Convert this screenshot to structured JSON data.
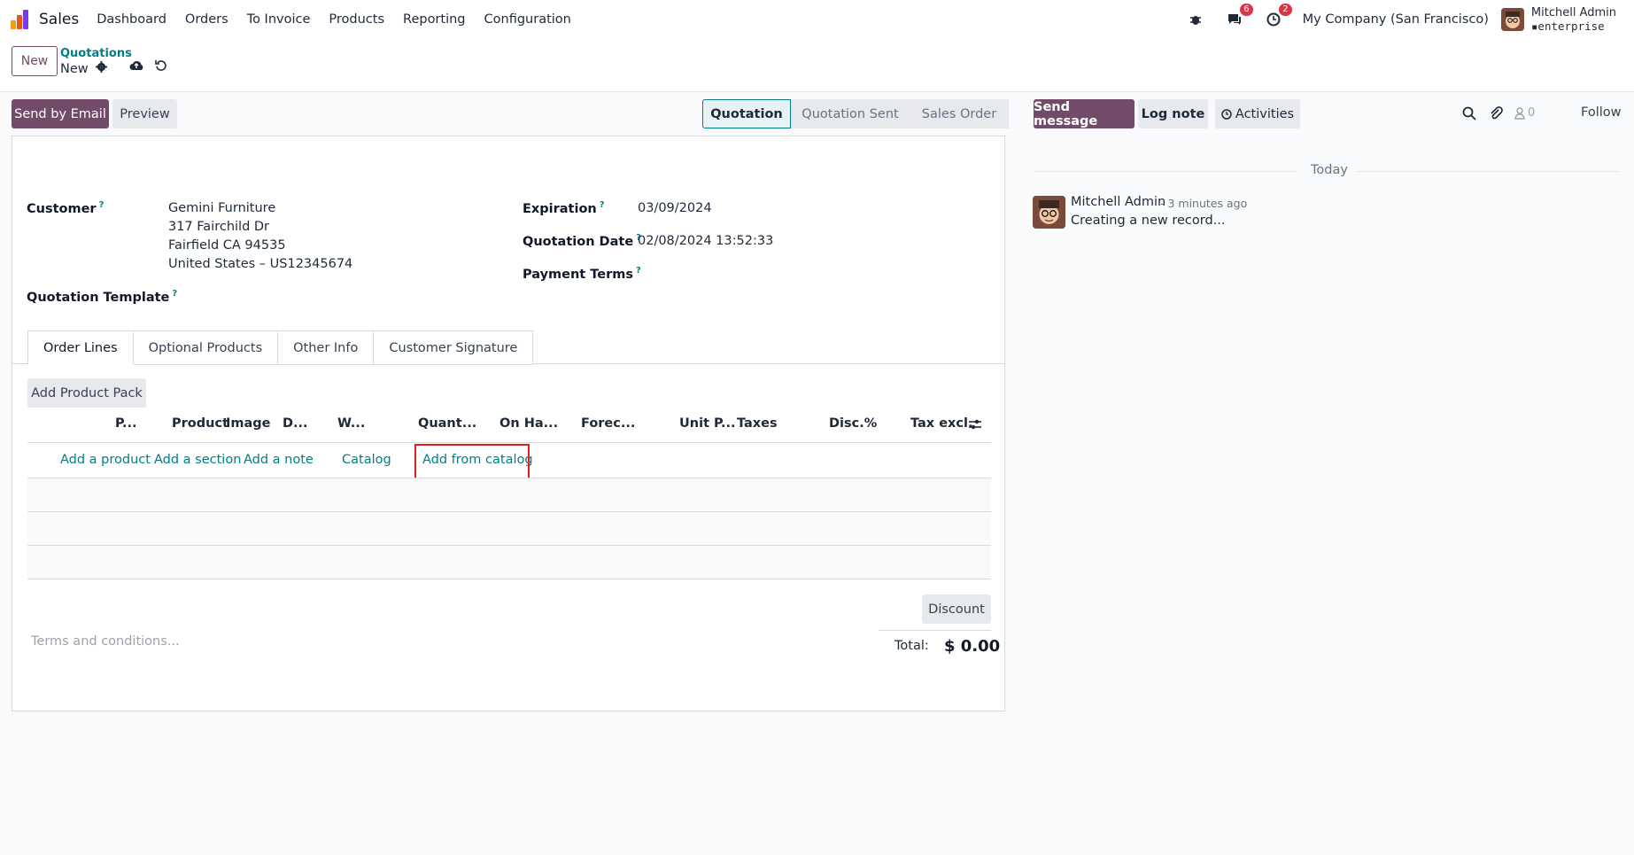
{
  "app": {
    "name": "Sales"
  },
  "menu": [
    "Dashboard",
    "Orders",
    "To Invoice",
    "Products",
    "Reporting",
    "Configuration"
  ],
  "nav": {
    "chat_count": "6",
    "activity_count": "2",
    "company": "My Company (San Francisco)",
    "user": "Mitchell Admin",
    "database": "enterprise"
  },
  "breadcrumb": {
    "parent": "Quotations",
    "current": "New"
  },
  "buttons": {
    "new": "New",
    "send_email": "Send by Email",
    "preview": "Preview",
    "add_pack": "Add Product Pack",
    "discount": "Discount"
  },
  "status_stages": [
    "Quotation",
    "Quotation Sent",
    "Sales Order"
  ],
  "form": {
    "customer_label": "Customer",
    "customer_name": "Gemini Furniture",
    "customer_addr1": "317 Fairchild Dr",
    "customer_addr2": "Fairfield CA 94535",
    "customer_addr3": "United States – US12345674",
    "template_label": "Quotation Template",
    "expiration_label": "Expiration",
    "expiration_value": "03/09/2024",
    "qdate_label": "Quotation Date",
    "qdate_value": "02/08/2024 13:52:33",
    "payment_label": "Payment Terms",
    "help": "?"
  },
  "tabs": [
    "Order Lines",
    "Optional Products",
    "Other Info",
    "Customer Signature"
  ],
  "table_headers": [
    "P...",
    "Product",
    "Image",
    "D...",
    "W...",
    "Quant...",
    "On Ha...",
    "Forec...",
    "Unit P...",
    "Taxes",
    "Disc.%",
    "Tax excl."
  ],
  "line_actions": {
    "add_product": "Add a product",
    "add_section": "Add a section",
    "add_note": "Add a note",
    "catalog": "Catalog",
    "add_from_catalog": "Add from catalog"
  },
  "terms_placeholder": "Terms and conditions...",
  "totals": {
    "label": "Total:",
    "value": "$ 0.00"
  },
  "chatter": {
    "send_message": "Send message",
    "log_note": "Log note",
    "activities": "Activities",
    "attachments": "0",
    "follow": "Follow",
    "today": "Today",
    "author": "Mitchell Admin",
    "time": "- 3 minutes ago",
    "body": "Creating a new record..."
  },
  "colors": {
    "brand": "#714b67",
    "link": "#017e84",
    "highlight": "#e11d1d"
  }
}
